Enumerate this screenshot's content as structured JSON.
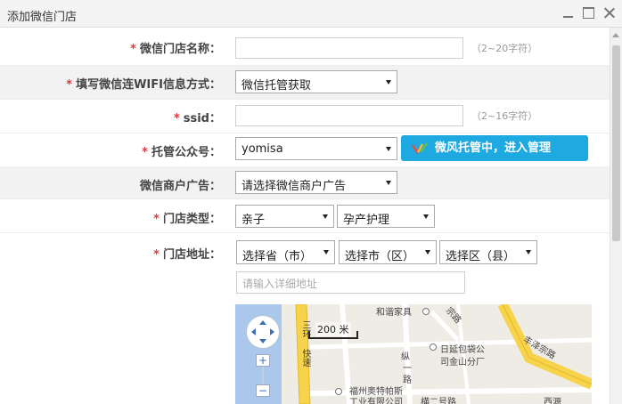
{
  "window": {
    "title": "添加微信门店"
  },
  "form": {
    "required_mark": "*",
    "store_name": {
      "label": "微信门店名称：",
      "value": "",
      "hint": "（2~20字符）"
    },
    "wifi_method": {
      "label": "填写微信连WIFI信息方式：",
      "selected": "微信托管获取"
    },
    "ssid": {
      "label": "ssid：",
      "value": "",
      "hint": "（2~16字符）"
    },
    "public_account": {
      "label": "托管公众号：",
      "selected": "yomisa",
      "button": "微风托管中，进入管理"
    },
    "merchant_ad": {
      "label": "微信商户广告：",
      "selected": "请选择微信商户广告"
    },
    "store_type": {
      "label": "门店类型：",
      "primary": "亲子",
      "secondary": "孕产护理"
    },
    "store_address": {
      "label": "门店地址：",
      "province": "选择省（市）",
      "city": "选择市（区）",
      "district": "选择区（县）",
      "detail_placeholder": "请输入详细地址"
    }
  },
  "map": {
    "scale": "200 米",
    "zoom_in": "+",
    "zoom_out": "−",
    "labels": {
      "harmony_furniture": "和谐家具",
      "ring_expressway_1": "三环",
      "ring_expressway_2": "快速",
      "road_zong": "纵",
      "road_yi": "一",
      "road_lu": "路",
      "rixin_1": "日延包袋公",
      "rixin_2": "司金山分厂",
      "fuzhou_1": "福州奥特帕斯",
      "fuzhou_2": "工业有限公司",
      "heng_road": "横二号路",
      "fengze_road": "丰泽宗路",
      "jishi_road": "宗路",
      "corner_text": "西源"
    }
  },
  "colors": {
    "accent": "#1fa9e1",
    "required": "#e4393c",
    "row_gray": "#f2f2f2"
  }
}
